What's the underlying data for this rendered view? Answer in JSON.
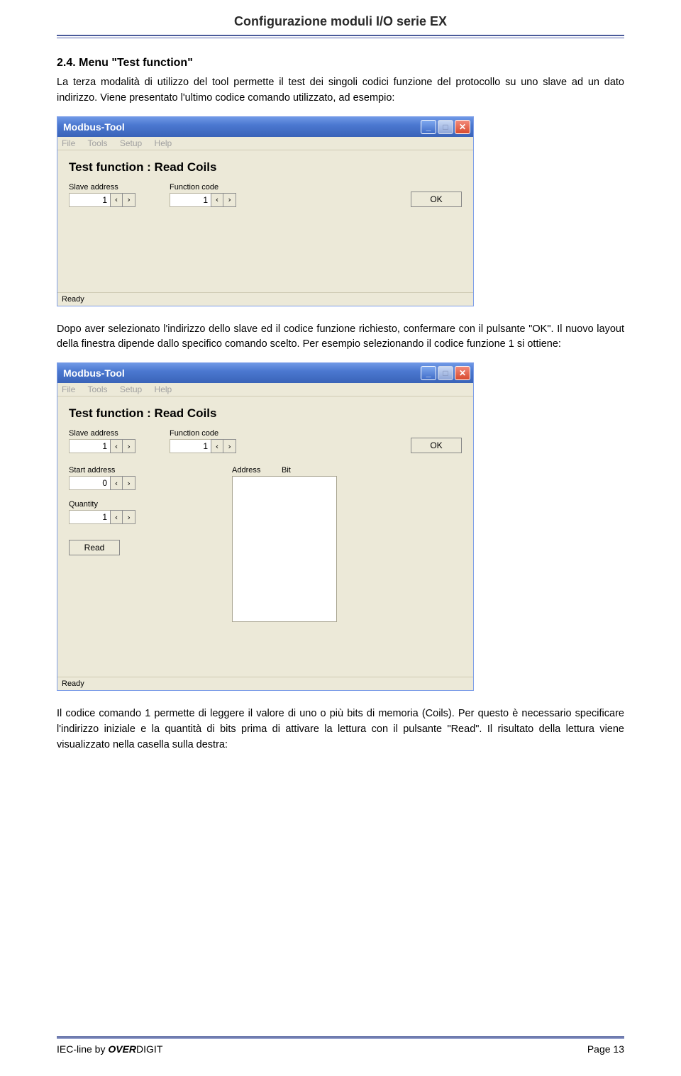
{
  "doc": {
    "header": "Configurazione moduli I/O serie EX",
    "section_num": "2.4.",
    "section_title": "Menu \"Test function\"",
    "para1": "La terza modalità di utilizzo del tool permette il test dei singoli codici funzione del protocollo su uno slave ad un dato indirizzo. Viene presentato l'ultimo codice comando utilizzato, ad esempio:",
    "para2": "Dopo aver selezionato l'indirizzo dello slave ed il codice funzione richiesto, confermare con il pulsante \"OK\". Il nuovo layout della finestra dipende dallo specifico comando scelto. Per esempio selezionando il codice funzione 1 si ottiene:",
    "para3": "Il codice comando 1 permette di leggere il valore di uno o più bits di memoria (Coils). Per questo è necessario specificare l'indirizzo iniziale e la quantità di bits prima di attivare la lettura con il pulsante \"Read\". Il risultato della lettura viene visualizzato nella casella sulla destra:",
    "footer_left_a": "IEC-line by ",
    "footer_left_b": "OVER",
    "footer_left_c": "DIGIT",
    "footer_right": "Page 13"
  },
  "app": {
    "title": "Modbus-Tool",
    "menu": {
      "file": "File",
      "tools": "Tools",
      "setup": "Setup",
      "help": "Help"
    },
    "tf_title": "Test function : Read Coils",
    "labels": {
      "slave": "Slave address",
      "func": "Function code",
      "start": "Start address",
      "qty": "Quantity",
      "addr": "Address",
      "bit": "Bit"
    },
    "values": {
      "slave": "1",
      "func": "1",
      "start": "0",
      "qty": "1"
    },
    "ok": "OK",
    "read": "Read",
    "status": "Ready"
  }
}
